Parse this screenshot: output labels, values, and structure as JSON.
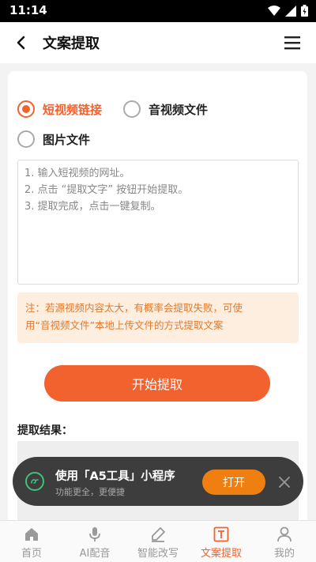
{
  "status": {
    "time": "11:14"
  },
  "appbar": {
    "title": "文案提取"
  },
  "options": {
    "short_video": "短视频链接",
    "audio_video": "音视频文件",
    "image": "图片文件"
  },
  "instructions": {
    "line1": "1. 输入短视频的网址。",
    "line2": "2. 点击 “提取文字” 按钮开始提取。",
    "line3": "3. 提取完成，点击一键复制。"
  },
  "notice": {
    "line1": "注：若源视频内容太大，有概率会提取失败，可使",
    "line2": "用“音视频文件”本地上传文件的方式提取文案"
  },
  "start_button": "开始提取",
  "result_label": "提取结果：",
  "popup": {
    "title": "使用「A5工具」小程序",
    "subtitle": "功能更全，更便捷",
    "open_label": "打开"
  },
  "nav": {
    "items": [
      {
        "label": "首页",
        "icon": "home-icon"
      },
      {
        "label": "AI配音",
        "icon": "mic-icon"
      },
      {
        "label": "智能改写",
        "icon": "edit-icon"
      },
      {
        "label": "文案提取",
        "icon": "text-icon"
      },
      {
        "label": "我的",
        "icon": "user-icon"
      }
    ]
  },
  "colors": {
    "accent": "#f2622e",
    "notice_text": "#e07a2e",
    "popup_bg": "#3d3d3d",
    "open_button": "#f07f12"
  }
}
